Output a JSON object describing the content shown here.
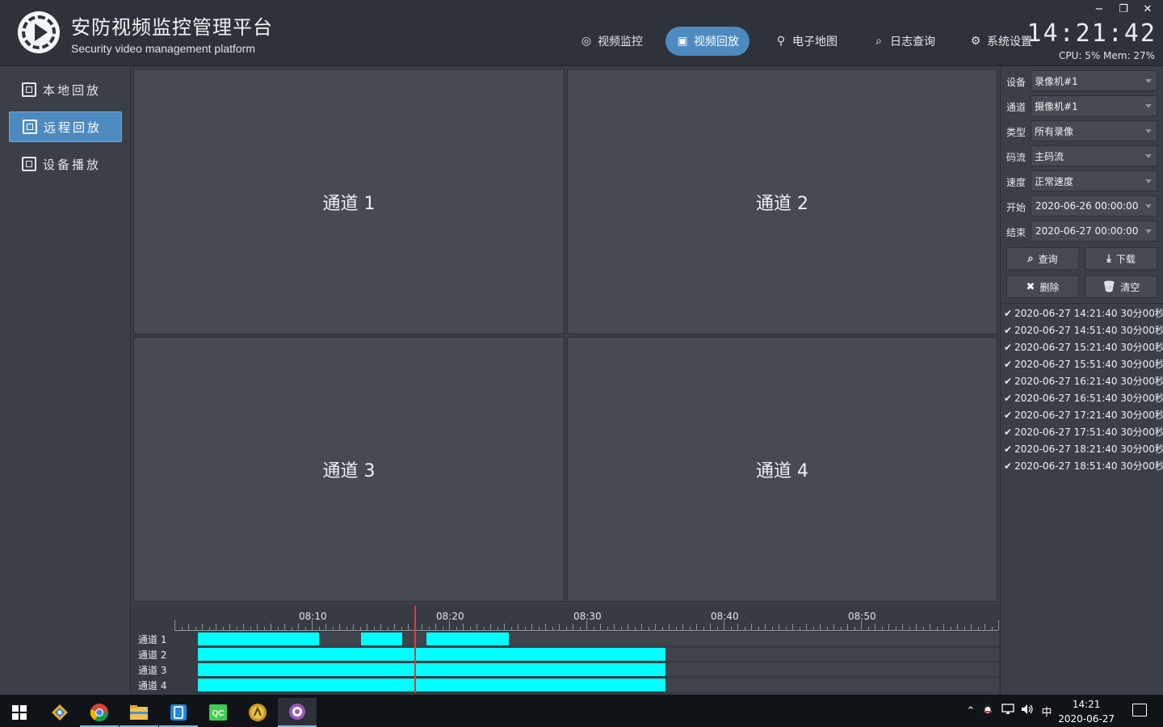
{
  "header": {
    "title": "安防视频监控管理平台",
    "subtitle": "Security video management platform",
    "clock": "14:21:42",
    "cpu_mem": "CPU: 5% Mem: 27%",
    "window_controls": [
      "−",
      "❐",
      "✕"
    ]
  },
  "nav": [
    {
      "label": "视频监控",
      "icon": "webcam-icon",
      "glyph": "◎",
      "active": false
    },
    {
      "label": "视频回放",
      "icon": "film-icon",
      "glyph": "▣",
      "active": true
    },
    {
      "label": "电子地图",
      "icon": "map-person-icon",
      "glyph": "⚲",
      "active": false
    },
    {
      "label": "日志查询",
      "icon": "search-icon",
      "glyph": "⌕",
      "active": false
    },
    {
      "label": "系统设置",
      "icon": "gears-icon",
      "glyph": "⚙",
      "active": false
    }
  ],
  "sidebar": {
    "items": [
      {
        "label": "本地回放",
        "active": false
      },
      {
        "label": "远程回放",
        "active": true
      },
      {
        "label": "设备播放",
        "active": false
      }
    ]
  },
  "videos": [
    "通道 1",
    "通道 2",
    "通道 3",
    "通道 4"
  ],
  "timeline": {
    "tick_labels": [
      "08:10",
      "08:20",
      "08:30",
      "08:40",
      "08:50"
    ],
    "channels": [
      "通道 1",
      "通道 2",
      "通道 3",
      "通道 4"
    ],
    "cursor_time": "08:17:30",
    "segment_color": "#00ffff",
    "cursor_color": "#e23b3b",
    "segments": [
      [
        [
          "08:01:45",
          "08:10:35"
        ],
        [
          "08:13:40",
          "08:16:40"
        ],
        [
          "08:18:25",
          "08:24:25"
        ]
      ],
      [
        [
          "08:01:45",
          "08:35:50"
        ]
      ],
      [
        [
          "08:01:45",
          "08:35:50"
        ]
      ],
      [
        [
          "08:01:45",
          "08:35:50"
        ]
      ]
    ]
  },
  "filters": {
    "device": {
      "label": "设备",
      "value": "录像机#1"
    },
    "channel": {
      "label": "通道",
      "value": "摄像机#1"
    },
    "type": {
      "label": "类型",
      "value": "所有录像"
    },
    "stream": {
      "label": "码流",
      "value": "主码流"
    },
    "speed": {
      "label": "速度",
      "value": "正常速度"
    },
    "start": {
      "label": "开始",
      "value": "2020-06-26 00:00:00"
    },
    "end": {
      "label": "结束",
      "value": "2020-06-27 00:00:00"
    }
  },
  "buttons": {
    "query": "查询",
    "download": "下载",
    "delete": "删除",
    "clear": "清空"
  },
  "records": [
    "2020-06-27 14:21:40 30分00秒",
    "2020-06-27 14:51:40 30分00秒",
    "2020-06-27 15:21:40 30分00秒",
    "2020-06-27 15:51:40 30分00秒",
    "2020-06-27 16:21:40 30分00秒",
    "2020-06-27 16:51:40 30分00秒",
    "2020-06-27 17:21:40 30分00秒",
    "2020-06-27 17:51:40 30分00秒",
    "2020-06-27 18:21:40 30分00秒",
    "2020-06-27 18:51:40 30分00秒"
  ],
  "taskbar": {
    "apps": [
      "windows-start-icon",
      "git-icon",
      "chrome-icon",
      "file-explorer-icon",
      "phone-app-icon",
      "qt-creator-icon",
      "foobar-icon",
      "chat-app-icon"
    ],
    "tray_icons": [
      "chevron-up-icon",
      "qq-icon",
      "network-icon",
      "volume-icon"
    ],
    "ime": "中",
    "time": "14:21",
    "date": "2020-06-27"
  }
}
